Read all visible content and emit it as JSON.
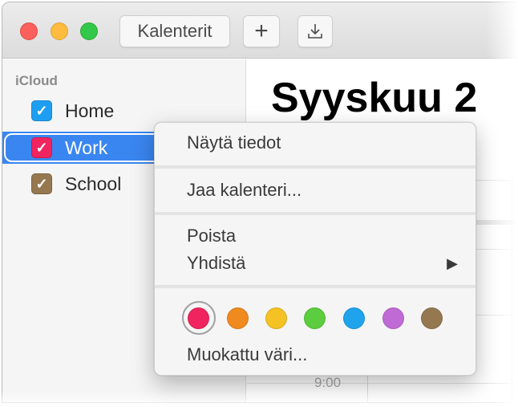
{
  "window": {
    "toolbar": {
      "calendars_label": "Kalenterit",
      "add_icon": "plus-icon",
      "add_glyph": "+",
      "export_icon": "download-icon"
    }
  },
  "sidebar": {
    "group_label": "iCloud",
    "calendars": [
      {
        "label": "Home",
        "color": "#1e9ef0",
        "checked": true,
        "selected": false
      },
      {
        "label": "Work",
        "color": "#f0245e",
        "checked": true,
        "selected": true
      },
      {
        "label": "School",
        "color": "#957850",
        "checked": true,
        "selected": false
      }
    ],
    "check_glyph": "✓"
  },
  "main": {
    "month_title": "Syyskuu 2",
    "time_label": "9:00"
  },
  "context_menu": {
    "items": [
      {
        "label": "Näytä tiedot"
      },
      {
        "label": "Jaa kalenteri..."
      },
      {
        "label": "Poista"
      },
      {
        "label": "Yhdistä",
        "submenu": true
      }
    ],
    "submenu_glyph": "▶",
    "colors": [
      {
        "name": "red",
        "hex": "#f0245e",
        "selected": true
      },
      {
        "name": "orange",
        "hex": "#f08a1e"
      },
      {
        "name": "yellow",
        "hex": "#f5c225"
      },
      {
        "name": "green",
        "hex": "#5ccd3e"
      },
      {
        "name": "blue",
        "hex": "#1fa3ec"
      },
      {
        "name": "purple",
        "hex": "#c06ad6"
      },
      {
        "name": "brown",
        "hex": "#957850"
      }
    ],
    "custom_color_label": "Muokattu väri..."
  }
}
